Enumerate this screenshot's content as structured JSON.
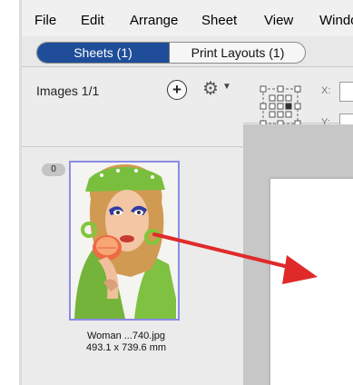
{
  "menubar": {
    "items": [
      {
        "label": "File"
      },
      {
        "label": "Edit"
      },
      {
        "label": "Arrange"
      },
      {
        "label": "Sheet"
      },
      {
        "label": "View"
      },
      {
        "label": "Windo"
      }
    ]
  },
  "tabs": [
    {
      "label": "Sheets (1)",
      "active": true
    },
    {
      "label": "Print Layouts (1)",
      "active": false
    }
  ],
  "images_panel": {
    "title": "Images 1/1",
    "item": {
      "badge": "0",
      "filename": "Woman ...740.jpg",
      "dimensions": "493.1 x 739.6 mm"
    }
  },
  "properties": {
    "x_label": "X:",
    "y_label": "Y:"
  },
  "colors": {
    "accent": "#1f4d99",
    "arrow": "#e02a2a",
    "selection": "#8b8be6"
  },
  "icons": [
    "add-icon",
    "gear-icon",
    "chevron-down-icon",
    "transform-handles-icon"
  ]
}
